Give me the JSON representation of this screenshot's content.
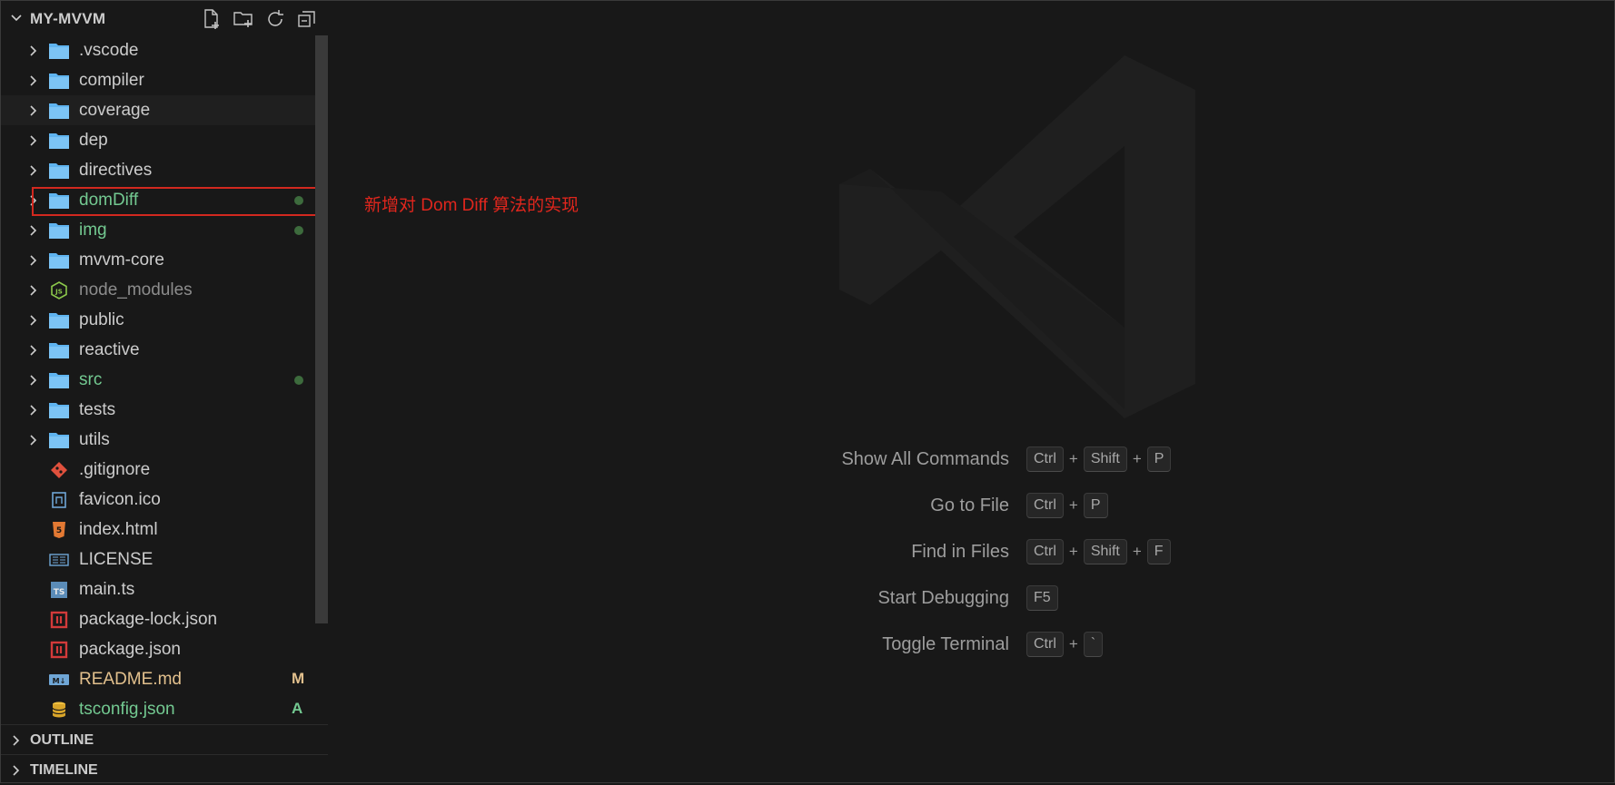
{
  "explorer": {
    "title": "MY-MVVM",
    "actions": [
      {
        "name": "new-file-icon"
      },
      {
        "name": "new-folder-icon"
      },
      {
        "name": "refresh-icon"
      },
      {
        "name": "collapse-all-icon"
      }
    ],
    "items": [
      {
        "label": ".vscode",
        "type": "folder",
        "color": "#cccccc",
        "status": ""
      },
      {
        "label": "compiler",
        "type": "folder",
        "color": "#cccccc",
        "status": ""
      },
      {
        "label": "coverage",
        "type": "folder",
        "color": "#cccccc",
        "status": ""
      },
      {
        "label": "dep",
        "type": "folder",
        "color": "#cccccc",
        "status": ""
      },
      {
        "label": "directives",
        "type": "folder",
        "color": "#cccccc",
        "status": ""
      },
      {
        "label": "domDiff",
        "type": "folder",
        "color": "#73c991",
        "status": "dot"
      },
      {
        "label": "img",
        "type": "folder",
        "color": "#73c991",
        "status": "dot"
      },
      {
        "label": "mvvm-core",
        "type": "folder",
        "color": "#cccccc",
        "status": ""
      },
      {
        "label": "node_modules",
        "type": "node-folder",
        "color": "#8c8c8c",
        "status": ""
      },
      {
        "label": "public",
        "type": "folder",
        "color": "#cccccc",
        "status": ""
      },
      {
        "label": "reactive",
        "type": "folder",
        "color": "#cccccc",
        "status": ""
      },
      {
        "label": "src",
        "type": "folder",
        "color": "#73c991",
        "status": "dot"
      },
      {
        "label": "tests",
        "type": "folder",
        "color": "#cccccc",
        "status": ""
      },
      {
        "label": "utils",
        "type": "folder",
        "color": "#cccccc",
        "status": ""
      },
      {
        "label": ".gitignore",
        "type": "git",
        "color": "#cccccc",
        "status": ""
      },
      {
        "label": "favicon.ico",
        "type": "image",
        "color": "#cccccc",
        "status": ""
      },
      {
        "label": "index.html",
        "type": "html",
        "color": "#cccccc",
        "status": ""
      },
      {
        "label": "LICENSE",
        "type": "license",
        "color": "#cccccc",
        "status": ""
      },
      {
        "label": "main.ts",
        "type": "ts",
        "color": "#cccccc",
        "status": ""
      },
      {
        "label": "package-lock.json",
        "type": "npm",
        "color": "#cccccc",
        "status": ""
      },
      {
        "label": "package.json",
        "type": "npm",
        "color": "#cccccc",
        "status": ""
      },
      {
        "label": "README.md",
        "type": "markdown",
        "color": "#e2c08d",
        "status": "M"
      },
      {
        "label": "tsconfig.json",
        "type": "tsconfig",
        "color": "#73c991",
        "status": "A"
      }
    ]
  },
  "panels": {
    "outline": "OUTLINE",
    "timeline": "TIMELINE"
  },
  "annotation": "新增对 Dom Diff 算法的实现",
  "shortcuts": [
    {
      "label": "Show All Commands",
      "keys": [
        "Ctrl",
        "Shift",
        "P"
      ]
    },
    {
      "label": "Go to File",
      "keys": [
        "Ctrl",
        "P"
      ]
    },
    {
      "label": "Find in Files",
      "keys": [
        "Ctrl",
        "Shift",
        "F"
      ]
    },
    {
      "label": "Start Debugging",
      "keys": [
        "F5"
      ]
    },
    {
      "label": "Toggle Terminal",
      "keys": [
        "Ctrl",
        "`"
      ]
    }
  ],
  "colors": {
    "background": "#181818",
    "git_added": "#73c991",
    "git_modified": "#e2c08d",
    "annotation_red": "#e0261d",
    "folder_blue": "#5fb4f0"
  }
}
